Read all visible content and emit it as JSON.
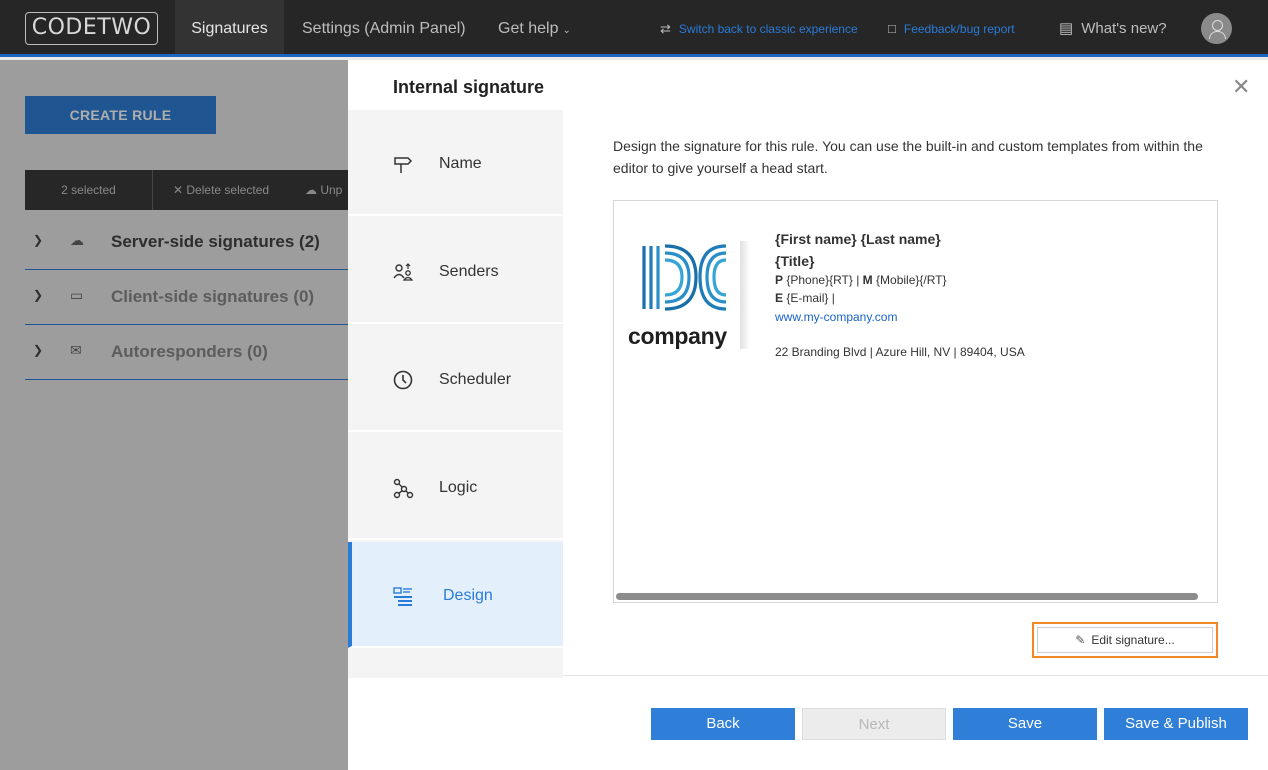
{
  "topbar": {
    "logo": "CODETWO",
    "nav": {
      "signatures": "Signatures",
      "settings": "Settings (Admin Panel)",
      "help": "Get help"
    },
    "switch_link": "Switch back to classic experience",
    "feedback_link": "Feedback/bug report",
    "whats_new": "What's new?"
  },
  "background": {
    "create_rule": "CREATE RULE",
    "selection": {
      "count": "2 selected",
      "delete": "Delete selected",
      "unpublish": "Unp"
    },
    "groups": [
      {
        "label": "Server-side signatures (2)",
        "icon": "cloud-icon"
      },
      {
        "label": "Client-side signatures (0)",
        "icon": "monitor-icon"
      },
      {
        "label": "Autoresponders (0)",
        "icon": "mail-reply-icon"
      }
    ]
  },
  "modal": {
    "title": "Internal signature",
    "steps": [
      {
        "label": "Name",
        "icon": "signpost-icon"
      },
      {
        "label": "Senders",
        "icon": "users-icon"
      },
      {
        "label": "Scheduler",
        "icon": "clock-icon"
      },
      {
        "label": "Logic",
        "icon": "logic-graph-icon"
      },
      {
        "label": "Design",
        "icon": "layout-design-icon",
        "active": true
      }
    ],
    "intro": "Design the signature for this rule. You can use the built-in and custom templates from within the editor to give yourself a head start.",
    "signature": {
      "logo_text": "company",
      "name": "{First name} {Last name}",
      "title": "{Title}",
      "phone_prefix": "P",
      "phone": "{Phone}{RT}",
      "mobile_prefix": "M",
      "mobile": "{Mobile}{/RT}",
      "email_prefix": "E",
      "email": "{E-mail} |",
      "website": "www.my-company.com",
      "address": "22 Branding Blvd | Azure Hill, NV | 89404, USA"
    },
    "edit_button": "Edit signature...",
    "footer": {
      "back": "Back",
      "next": "Next",
      "save": "Save",
      "publish": "Save & Publish"
    }
  },
  "colors": {
    "accent": "#2f7fd8",
    "highlight": "#f08a24",
    "topbar": "#262626"
  }
}
